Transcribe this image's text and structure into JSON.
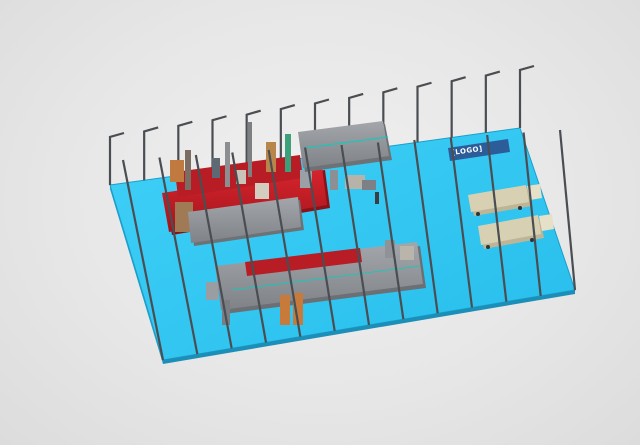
{
  "scene": {
    "background": "#e6e6e6",
    "floor_color": "#2fc6f2",
    "floor_edge_color": "#1a9fcc",
    "column_color": "#4a4e52",
    "machine_grey": "#8e9296",
    "machine_red": "#c8202a",
    "truck_color": "#d8d0b2"
  },
  "sign": {
    "text": "[LOGO]"
  }
}
